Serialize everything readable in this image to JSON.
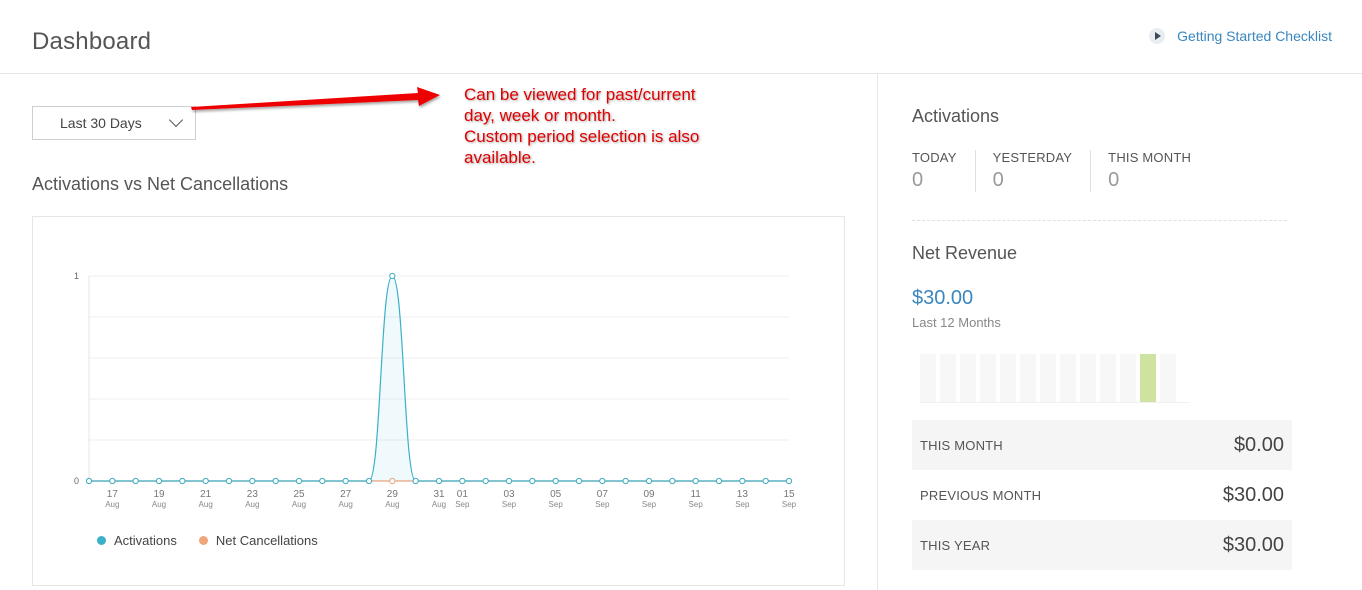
{
  "header": {
    "title": "Dashboard",
    "checklist_label": "Getting Started Checklist"
  },
  "filters": {
    "period": "Last 30 Days"
  },
  "chart_section": {
    "title": "Activations vs Net Cancellations"
  },
  "chart_data": {
    "type": "line",
    "title": "Activations vs Net Cancellations",
    "xlabel": "",
    "ylabel": "",
    "ylim": [
      0,
      1
    ],
    "y_ticks": [
      "0",
      "1"
    ],
    "x_ticks": [
      {
        "day": "17",
        "month": "Aug"
      },
      {
        "day": "19",
        "month": "Aug"
      },
      {
        "day": "21",
        "month": "Aug"
      },
      {
        "day": "23",
        "month": "Aug"
      },
      {
        "day": "25",
        "month": "Aug"
      },
      {
        "day": "27",
        "month": "Aug"
      },
      {
        "day": "29",
        "month": "Aug"
      },
      {
        "day": "31",
        "month": "Aug"
      },
      {
        "day": "01",
        "month": "Sep"
      },
      {
        "day": "03",
        "month": "Sep"
      },
      {
        "day": "05",
        "month": "Sep"
      },
      {
        "day": "07",
        "month": "Sep"
      },
      {
        "day": "09",
        "month": "Sep"
      },
      {
        "day": "11",
        "month": "Sep"
      },
      {
        "day": "13",
        "month": "Sep"
      },
      {
        "day": "15",
        "month": "Sep"
      }
    ],
    "x": [
      "Aug 16",
      "Aug 17",
      "Aug 18",
      "Aug 19",
      "Aug 20",
      "Aug 21",
      "Aug 22",
      "Aug 23",
      "Aug 24",
      "Aug 25",
      "Aug 26",
      "Aug 27",
      "Aug 28",
      "Aug 29",
      "Aug 30",
      "Aug 31",
      "Sep 01",
      "Sep 02",
      "Sep 03",
      "Sep 04",
      "Sep 05",
      "Sep 06",
      "Sep 07",
      "Sep 08",
      "Sep 09",
      "Sep 10",
      "Sep 11",
      "Sep 12",
      "Sep 13",
      "Sep 14",
      "Sep 15"
    ],
    "series": [
      {
        "name": "Activations",
        "color": "#3bb0c9",
        "values": [
          0,
          0,
          0,
          0,
          0,
          0,
          0,
          0,
          0,
          0,
          0,
          0,
          0,
          1,
          0,
          0,
          0,
          0,
          0,
          0,
          0,
          0,
          0,
          0,
          0,
          0,
          0,
          0,
          0,
          0,
          0
        ]
      },
      {
        "name": "Net Cancellations",
        "color": "#f0a57a",
        "values": [
          0,
          0,
          0,
          0,
          0,
          0,
          0,
          0,
          0,
          0,
          0,
          0,
          0,
          0,
          0,
          0,
          0,
          0,
          0,
          0,
          0,
          0,
          0,
          0,
          0,
          0,
          0,
          0,
          0,
          0,
          0
        ]
      }
    ],
    "grid": true,
    "legend": "bottom-left"
  },
  "annotation": {
    "lines": [
      "Can be viewed for past/current",
      "day, week or month.",
      "Custom period selection is also",
      "available."
    ],
    "color": "#e00000"
  },
  "activations": {
    "title": "Activations",
    "stats": [
      {
        "label": "TODAY",
        "value": "0"
      },
      {
        "label": "YESTERDAY",
        "value": "0"
      },
      {
        "label": "THIS MONTH",
        "value": "0"
      }
    ]
  },
  "revenue": {
    "title": "Net Revenue",
    "value": "$30.00",
    "subtitle": "Last 12 Months",
    "monthly_bars": [
      0,
      0,
      0,
      0,
      0,
      0,
      0,
      0,
      0,
      0,
      0,
      30,
      0
    ],
    "bar_color": "#cfe3a0",
    "empty_bar_color": "#f7f7f7",
    "summary": [
      {
        "label": "THIS MONTH",
        "value": "$0.00"
      },
      {
        "label": "PREVIOUS MONTH",
        "value": "$30.00"
      },
      {
        "label": "THIS YEAR",
        "value": "$30.00"
      }
    ]
  }
}
